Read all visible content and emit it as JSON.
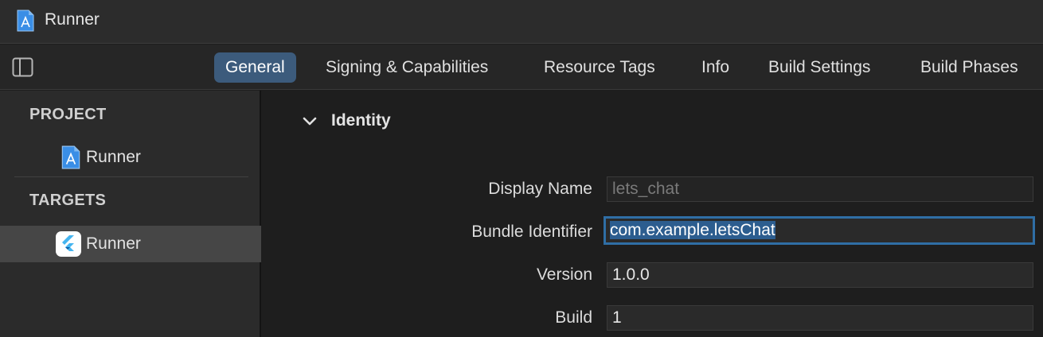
{
  "window": {
    "title": "Runner"
  },
  "tabs": [
    {
      "label": "General",
      "active": true
    },
    {
      "label": "Signing & Capabilities"
    },
    {
      "label": "Resource Tags"
    },
    {
      "label": "Info"
    },
    {
      "label": "Build Settings"
    },
    {
      "label": "Build Phases"
    }
  ],
  "sidebar": {
    "project_header": "PROJECT",
    "project_item": "Runner",
    "targets_header": "TARGETS",
    "target_item": "Runner"
  },
  "identity": {
    "title": "Identity",
    "display_name_label": "Display Name",
    "display_name_placeholder": "lets_chat",
    "bundle_id_label": "Bundle Identifier",
    "bundle_id_value": "com.example.letsChat",
    "version_label": "Version",
    "version_value": "1.0.0",
    "build_label": "Build",
    "build_value": "1"
  },
  "colors": {
    "accent": "#3c5b7c",
    "focus_ring": "#2f6ea5",
    "flutter_blue": "#45b5f0"
  },
  "icons": [
    "xcode-project-icon",
    "sidebar-toggle-icon",
    "chevron-down-icon",
    "flutter-app-icon"
  ]
}
